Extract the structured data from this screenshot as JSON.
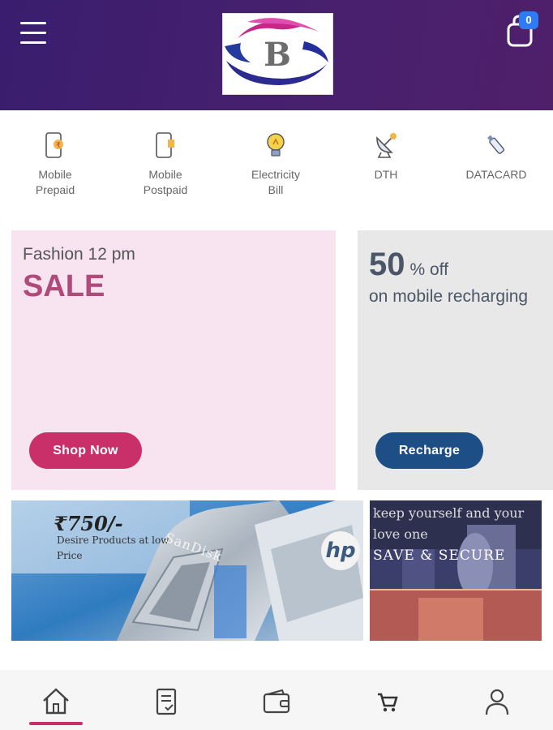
{
  "header": {
    "logo_letter": "B",
    "menu_icon": "hamburger-menu-icon",
    "cart_icon": "shopping-bag-icon",
    "cart_count": "0",
    "colors": {
      "gradient_start": "#3a1d6e",
      "gradient_end": "#4f1f6a",
      "badge": "#2f7bf6"
    }
  },
  "services": [
    {
      "label": "Mobile\nPrepaid",
      "icon": "mobile-prepaid-icon"
    },
    {
      "label": "Mobile\nPostpaid",
      "icon": "mobile-postpaid-icon"
    },
    {
      "label": "Electricity\nBill",
      "icon": "lightbulb-icon"
    },
    {
      "label": "DTH",
      "icon": "satellite-dish-icon"
    },
    {
      "label": "DATACARD",
      "icon": "usb-datacard-icon"
    }
  ],
  "promos": {
    "sale": {
      "subtitle": "Fashion 12 pm",
      "title": "SALE",
      "button": "Shop Now",
      "bg": "#f8e4f1",
      "accent": "#c9306a"
    },
    "recharge": {
      "percent": "50",
      "percent_unit": "% off",
      "desc": "on mobile recharging",
      "button": "Recharge",
      "bg": "#e8e8e8",
      "accent": "#1d4f86"
    }
  },
  "banners": {
    "usb": {
      "price": "₹750/-",
      "text": "Desire Products at low Price",
      "brand": "SanDisk",
      "logo": "hp"
    },
    "secure": {
      "line1": "keep yourself and your",
      "line2": "love one",
      "line3": "SAVE & SECURE"
    }
  },
  "bottom_nav": [
    {
      "icon": "home-icon",
      "active": true
    },
    {
      "icon": "receipt-icon",
      "active": false
    },
    {
      "icon": "wallet-icon",
      "active": false
    },
    {
      "icon": "cart-icon",
      "active": false
    },
    {
      "icon": "profile-icon",
      "active": false
    }
  ]
}
